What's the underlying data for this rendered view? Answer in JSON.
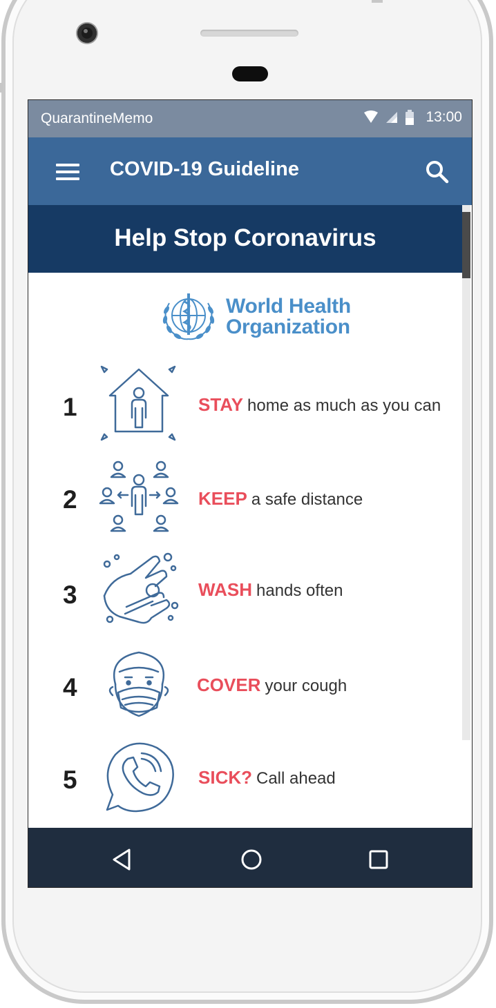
{
  "status_bar": {
    "app_name": "QuarantineMemo",
    "time": "13:00"
  },
  "app_bar": {
    "title": "COVID-19 Guideline"
  },
  "banner": {
    "title": "Help Stop Coronavirus"
  },
  "logo": {
    "line1": "World Health",
    "line2": "Organization"
  },
  "tips": [
    {
      "number": "1",
      "keyword": "STAY",
      "text": "home as much as you can",
      "icon": "house-icon"
    },
    {
      "number": "2",
      "keyword": "KEEP",
      "text": "a safe distance",
      "icon": "distance-icon"
    },
    {
      "number": "3",
      "keyword": "WASH",
      "text": "hands often",
      "icon": "hand-wash-icon"
    },
    {
      "number": "4",
      "keyword": "COVER",
      "text": "your cough",
      "icon": "face-mask-icon"
    },
    {
      "number": "5",
      "keyword": "SICK?",
      "text": "Call ahead",
      "icon": "phone-call-icon"
    }
  ],
  "colors": {
    "status_bar": "#7b8ba0",
    "app_bar": "#3b6899",
    "banner": "#163a64",
    "keyword": "#e94e5b",
    "icon_stroke": "#3f6a99",
    "nav_bar": "#1f2d3f"
  }
}
